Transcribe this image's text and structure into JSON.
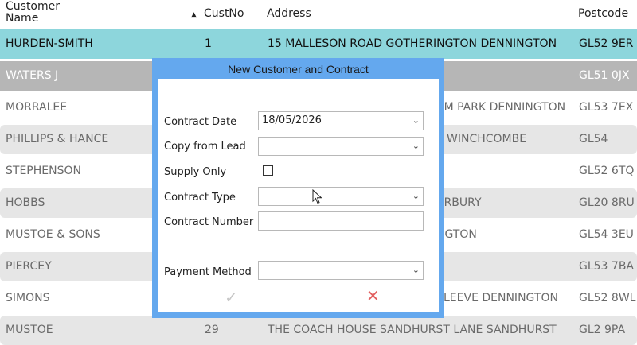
{
  "table": {
    "headers": {
      "name": "Customer Name",
      "sort_indicator": "▲",
      "custno": "CustNo",
      "address": "Address",
      "postcode": "Postcode"
    },
    "rows": [
      {
        "name": "HURDEN-SMITH",
        "custno": "1",
        "address": "15 MALLESON ROAD GOTHERINGTON DENNINGTON",
        "postcode": "GL52 9ER"
      },
      {
        "name": "WATERS J",
        "custno": "",
        "address": "",
        "postcode": "GL51 0JX"
      },
      {
        "name": "MORRALEE",
        "custno": "",
        "address": "AM PARK DENNINGTON",
        "postcode": "GL53 7EX"
      },
      {
        "name": "PHILLIPS & HANCE",
        "custno": "",
        "address": "WINCHCOMBE",
        "postcode": "GL54"
      },
      {
        "name": "STEPHENSON",
        "custno": "",
        "address": "",
        "postcode": "GL52 6TQ"
      },
      {
        "name": "HOBBS",
        "custno": "",
        "address": "ARBURY",
        "postcode": "GL20 8RU"
      },
      {
        "name": "MUSTOE & SONS",
        "custno": "",
        "address": "NGTON",
        "postcode": "GL54 3EU"
      },
      {
        "name": "PIERCEY",
        "custno": "",
        "address": "",
        "postcode": "GL53 7BA"
      },
      {
        "name": "SIMONS",
        "custno": "",
        "address": "LEEVE DENNINGTON",
        "postcode": "GL52 8WL"
      },
      {
        "name": "MUSTOE",
        "custno": "29",
        "address": "THE COACH HOUSE SANDHURST  LANE SANDHURST",
        "postcode": "GL2 9PA"
      }
    ]
  },
  "dialog": {
    "title": "New Customer and Contract",
    "contract_date_label": "Contract Date",
    "contract_date_value": "18/05/2026",
    "copy_from_lead_label": "Copy from Lead",
    "copy_from_lead_value": "",
    "supply_only_label": "Supply Only",
    "supply_only_checked": false,
    "contract_type_label": "Contract Type",
    "contract_type_value": "",
    "contract_number_label": "Contract Number",
    "contract_number_value": "",
    "payment_method_label": "Payment Method",
    "payment_method_value": "",
    "ok_glyph": "✓",
    "cancel_glyph": "✕",
    "chevron_glyph": "⌄"
  },
  "colors": {
    "dialog_frame": "#64a8ee",
    "row_selected": "#8dd6dc",
    "row_hover": "#b6b6b6",
    "row_alt": "#e6e6e6",
    "cancel": "#e26060"
  }
}
